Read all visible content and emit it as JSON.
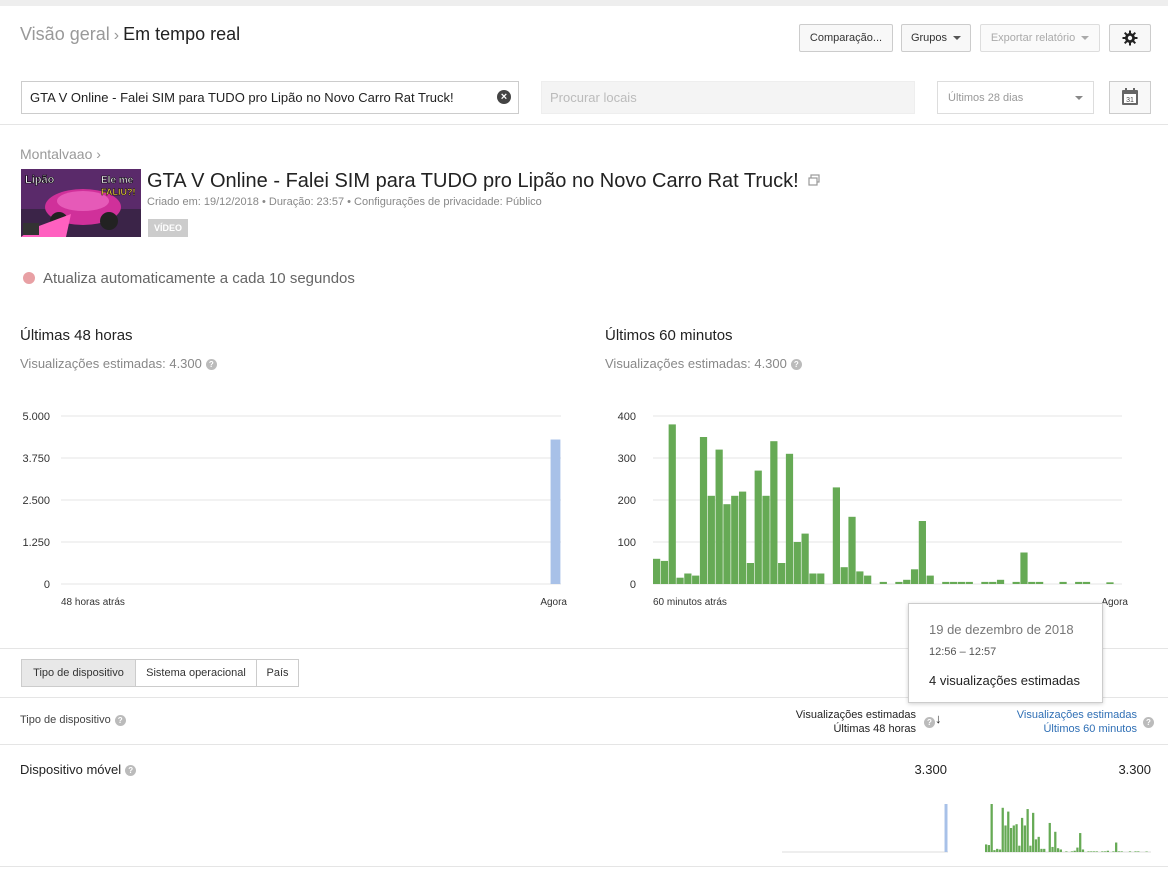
{
  "header": {
    "breadcrumb_parent": "Visão geral",
    "breadcrumb_sep": "›",
    "breadcrumb_current": "Em tempo real",
    "compare_label": "Comparação...",
    "groups_label": "Grupos",
    "export_label": "Exportar relatório",
    "settings_icon": "gear-icon"
  },
  "filters": {
    "search_value": "GTA V Online - Falei SIM para TUDO pro Lipão no Novo Carro Rat Truck!",
    "places_placeholder": "Procurar locais",
    "date_range": "Últimos 28 dias",
    "calendar_day": "31"
  },
  "video": {
    "channel": "Montalvaao",
    "channel_sep": "›",
    "title": "GTA V Online - Falei SIM para TUDO pro Lipão no Novo Carro Rat Truck!",
    "meta": "Criado em: 19/12/2018  •  Duração: 23:57  •  Configurações de privacidade: Público",
    "badge": "VÍDEO",
    "thumb_text_left": "Lipão",
    "thumb_text_right1": "Ele me",
    "thumb_text_right2": "FALIU?!"
  },
  "status": {
    "auto_update": "Atualiza automaticamente a cada 10 segundos",
    "dot_color": "#e8a0a4"
  },
  "panels": {
    "left": {
      "title": "Últimas 48 horas",
      "subtitle": "Visualizações estimadas: 4.300"
    },
    "right": {
      "title": "Últimos 60 minutos",
      "subtitle": "Visualizações estimadas: 4.300"
    }
  },
  "chart_data": [
    {
      "type": "bar",
      "title": "Últimas 48 horas",
      "color": "#a8c1e8",
      "y_ticks": [
        "5.000",
        "3.750",
        "2.500",
        "1.250",
        "0"
      ],
      "ylim": [
        0,
        5000
      ],
      "x_start_label": "48 horas atrás",
      "x_end_label": "Agora",
      "bins": 48,
      "values": [
        0,
        0,
        0,
        0,
        0,
        0,
        0,
        0,
        0,
        0,
        0,
        0,
        0,
        0,
        0,
        0,
        0,
        0,
        0,
        0,
        0,
        0,
        0,
        0,
        0,
        0,
        0,
        0,
        0,
        0,
        0,
        0,
        0,
        0,
        0,
        0,
        0,
        0,
        0,
        0,
        0,
        0,
        0,
        0,
        0,
        0,
        0,
        4300
      ]
    },
    {
      "type": "bar",
      "title": "Últimos 60 minutos",
      "color": "#66aa55",
      "y_ticks": [
        "400",
        "300",
        "200",
        "100",
        "0"
      ],
      "ylim": [
        0,
        400
      ],
      "x_start_label": "60 minutos atrás",
      "x_end_label": "Agora",
      "bins": 60,
      "values": [
        60,
        55,
        380,
        15,
        25,
        20,
        350,
        210,
        320,
        190,
        210,
        220,
        50,
        270,
        210,
        340,
        50,
        310,
        100,
        120,
        25,
        25,
        0,
        230,
        40,
        160,
        30,
        20,
        0,
        5,
        0,
        5,
        10,
        35,
        150,
        20,
        0,
        5,
        5,
        5,
        5,
        0,
        5,
        5,
        10,
        0,
        5,
        75,
        5,
        5,
        0,
        0,
        5,
        0,
        5,
        5,
        0,
        0,
        4,
        0
      ]
    }
  ],
  "tooltip": {
    "date": "19 de dezembro de 2018",
    "time": "12:56 – 12:57",
    "value": "4 visualizações estimadas"
  },
  "tabs": [
    {
      "label": "Tipo de dispositivo",
      "active": true
    },
    {
      "label": "Sistema operacional",
      "active": false
    },
    {
      "label": "País",
      "active": false
    }
  ],
  "table": {
    "dimension_header": "Tipo de dispositivo",
    "col1_line1": "Visualizações estimadas",
    "col1_line2": "Últimas 48 horas",
    "col2_line1": "Visualizações estimadas",
    "col2_line2": "Últimos 60 minutos",
    "link_color": "#2f6fb5",
    "rows": [
      {
        "label": "Dispositivo móvel",
        "v48": "3.300",
        "v60": "3.300"
      }
    ]
  }
}
